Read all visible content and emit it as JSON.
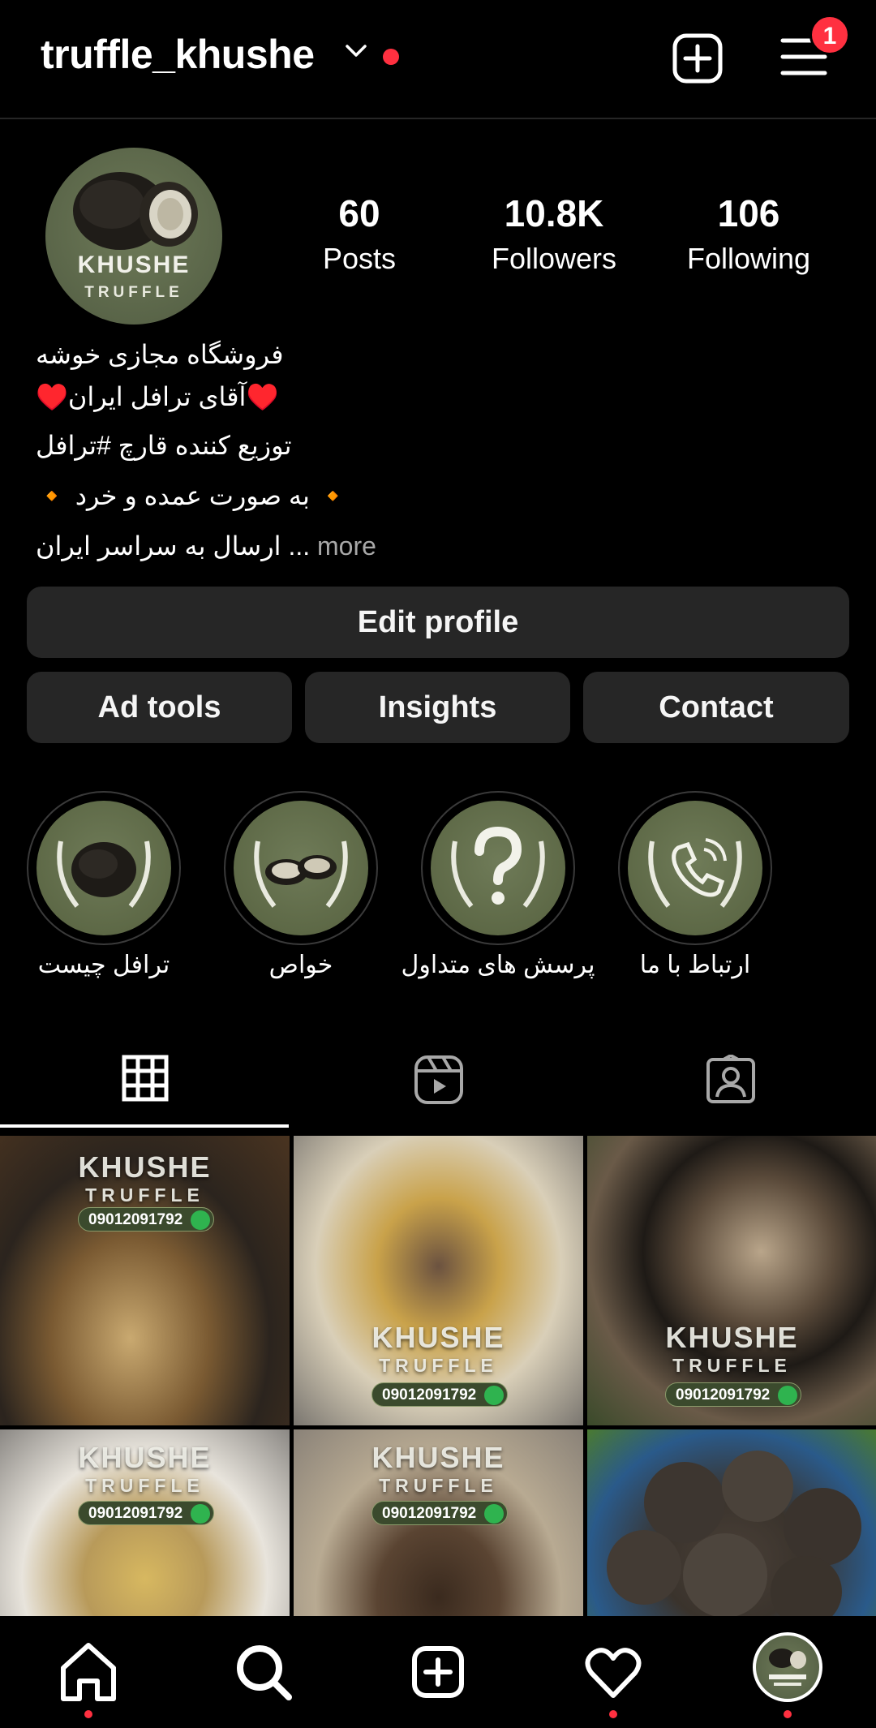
{
  "header": {
    "username": "truffle_khushe",
    "notification_count": "1"
  },
  "profile": {
    "avatar_line1": "KHUSHE",
    "avatar_line2": "TRUFFLE",
    "stats": [
      {
        "value": "60",
        "label": "Posts"
      },
      {
        "value": "10.8K",
        "label": "Followers"
      },
      {
        "value": "106",
        "label": "Following"
      }
    ],
    "bio": [
      "فروشگاه مجازی خوشه",
      "♥️آقای ترافل ایران♥️",
      "توزیع کننده قارچ #ترافل",
      "🔸 به صورت عمده و خرد 🔸",
      "ارسال به سراسر ایران ..."
    ],
    "more_label": "more"
  },
  "buttons": {
    "edit_profile": "Edit profile",
    "ad_tools": "Ad tools",
    "insights": "Insights",
    "contact": "Contact"
  },
  "highlights": [
    {
      "label": "ترافل چیست",
      "icon": "truffle-icon"
    },
    {
      "label": "خواص",
      "icon": "sliced-truffle-icon"
    },
    {
      "label": "پرسش های متداول",
      "icon": "question-mark-icon"
    },
    {
      "label": "ارتباط با ما",
      "icon": "phone-icon"
    }
  ],
  "tabs": [
    {
      "name": "grid-icon",
      "active": true
    },
    {
      "name": "reels-icon",
      "active": false
    },
    {
      "name": "tagged-icon",
      "active": false
    }
  ],
  "posts": [
    {
      "brand": "KHUSHE",
      "sub": "TRUFFLE",
      "phone": "09012091792"
    },
    {
      "brand": "KHUSHE",
      "sub": "TRUFFLE",
      "phone": "09012091792"
    },
    {
      "brand": "KHUSHE",
      "sub": "TRUFFLE",
      "phone": "09012091792"
    },
    {
      "brand": "KHUSHE",
      "sub": "TRUFFLE",
      "phone": "09012091792"
    },
    {
      "brand": "KHUSHE",
      "sub": "TRUFFLE",
      "phone": "09012091792"
    },
    {
      "brand": "",
      "sub": "",
      "phone": ""
    }
  ],
  "nav": [
    "home-icon",
    "search-icon",
    "create-icon",
    "activity-icon",
    "profile-avatar"
  ],
  "colors": {
    "accent_red": "#ff3040",
    "button_bg": "#262626",
    "olive": "#5f6a48"
  }
}
